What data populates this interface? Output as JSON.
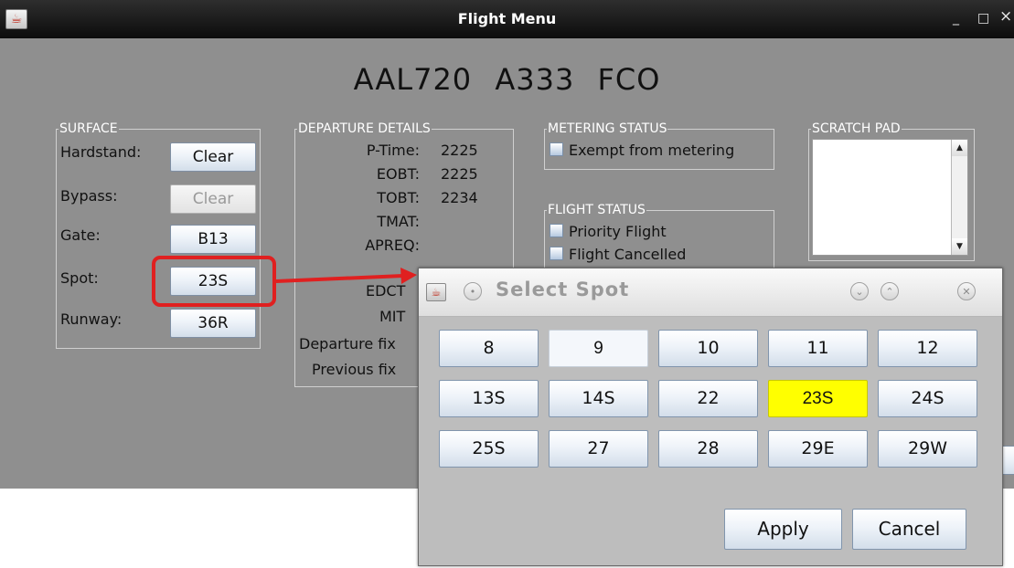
{
  "window": {
    "title": "Flight Menu",
    "minimize": "_",
    "maximize": "□",
    "close": "×"
  },
  "flight": {
    "callsign": "AAL720",
    "aircraft": "A333",
    "destination": "FCO"
  },
  "surface": {
    "legend": "SURFACE",
    "hardstand_label": "Hardstand:",
    "hardstand_value": "Clear",
    "bypass_label": "Bypass:",
    "bypass_value": "Clear",
    "gate_label": "Gate:",
    "gate_value": "B13",
    "spot_label": "Spot:",
    "spot_value": "23S",
    "runway_label": "Runway:",
    "runway_value": "36R"
  },
  "departure": {
    "legend": "DEPARTURE DETAILS",
    "rows": [
      {
        "label": "P-Time:",
        "value": "2225"
      },
      {
        "label": "EOBT:",
        "value": "2225"
      },
      {
        "label": "TOBT:",
        "value": "2234"
      },
      {
        "label": "TMAT:",
        "value": ""
      },
      {
        "label": "APREQ:",
        "value": ""
      },
      {
        "label": "EDCT",
        "value": ""
      },
      {
        "label": "MIT",
        "value": ""
      },
      {
        "label": "Departure fix",
        "value": ""
      },
      {
        "label": "Previous fix",
        "value": ""
      }
    ]
  },
  "metering": {
    "legend": "METERING STATUS",
    "exempt_label": "Exempt from metering"
  },
  "flight_status": {
    "legend": "FLIGHT STATUS",
    "priority_label": "Priority Flight",
    "cancelled_label": "Flight Cancelled"
  },
  "scratch": {
    "legend": "SCRATCH PAD",
    "content": ""
  },
  "dialog": {
    "title": "Select Spot",
    "spots": [
      [
        "8",
        "9",
        "10",
        "11",
        "12"
      ],
      [
        "13S",
        "14S",
        "22",
        "23S",
        "24S"
      ],
      [
        "25S",
        "27",
        "28",
        "29E",
        "29W"
      ]
    ],
    "selected_spot": "23S",
    "apply_label": "Apply",
    "cancel_label": "Cancel"
  },
  "colors": {
    "highlight": "#e02020",
    "selected_spot": "#ffff00"
  }
}
